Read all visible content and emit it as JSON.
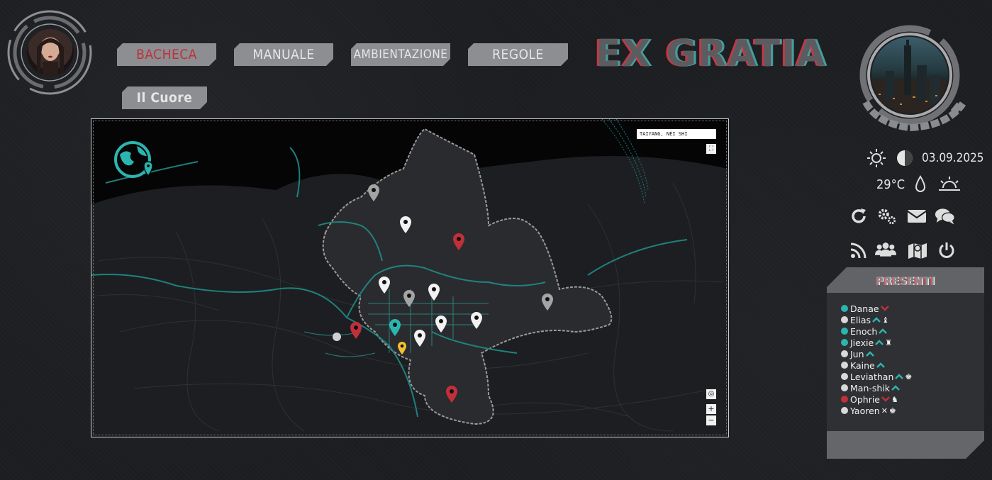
{
  "nav": {
    "tabs": [
      {
        "label": "BACHECA",
        "active": true
      },
      {
        "label": "MANUALE",
        "active": false
      },
      {
        "label": "AMBIENTAZIONE",
        "active": false
      },
      {
        "label": "REGOLE",
        "active": false
      }
    ],
    "sub_tab": "Il Cuore"
  },
  "logo": {
    "text": "EX GRATIA"
  },
  "map": {
    "search_value": "TAIYANG, NÈI SHÌ",
    "controls": {
      "zoom_in": "+",
      "zoom_out": "−"
    },
    "pin_colors": {
      "white": "#f2f2f2",
      "grey": "#a4a4a4",
      "red": "#c0303a",
      "teal": "#2bb5b0",
      "yellow": "#f2c032"
    }
  },
  "weather": {
    "date": "03.09.2025",
    "temperature": "29°C",
    "icons": [
      "sun-icon",
      "moon-icon",
      "drop-icon",
      "sunrise-icon"
    ]
  },
  "toolbar": {
    "icons": [
      "refresh-icon",
      "settings-icon",
      "mail-icon",
      "chat-icon",
      "rss-icon",
      "users-icon",
      "map-icon",
      "power-icon"
    ]
  },
  "presenti": {
    "title": "PRESENTI",
    "users": [
      {
        "name": "Danae",
        "dot": "#2bb5b0",
        "mark": "v",
        "extra": ""
      },
      {
        "name": "Elias",
        "dot": "#d9d9d9",
        "mark": "^",
        "extra": "♝"
      },
      {
        "name": "Enoch",
        "dot": "#2bb5b0",
        "mark": "^",
        "extra": ""
      },
      {
        "name": "Jiexie",
        "dot": "#2bb5b0",
        "mark": "^",
        "extra": "♜"
      },
      {
        "name": "Jun",
        "dot": "#d9d9d9",
        "mark": "^",
        "extra": ""
      },
      {
        "name": "Kaine",
        "dot": "#d9d9d9",
        "mark": "^",
        "extra": ""
      },
      {
        "name": "Leviathan",
        "dot": "#d9d9d9",
        "mark": "^",
        "extra": "♚"
      },
      {
        "name": "Man-shik",
        "dot": "#d9d9d9",
        "mark": "^",
        "extra": ""
      },
      {
        "name": "Ophrie",
        "dot": "#c0303a",
        "mark": "v",
        "extra": "♞"
      },
      {
        "name": "Yaoren",
        "dot": "#d9d9d9",
        "mark": "x",
        "extra": "♚"
      }
    ]
  },
  "colors": {
    "accent_red": "#c0303a",
    "accent_teal": "#2bb5b0",
    "panel": "#5b5c60"
  }
}
